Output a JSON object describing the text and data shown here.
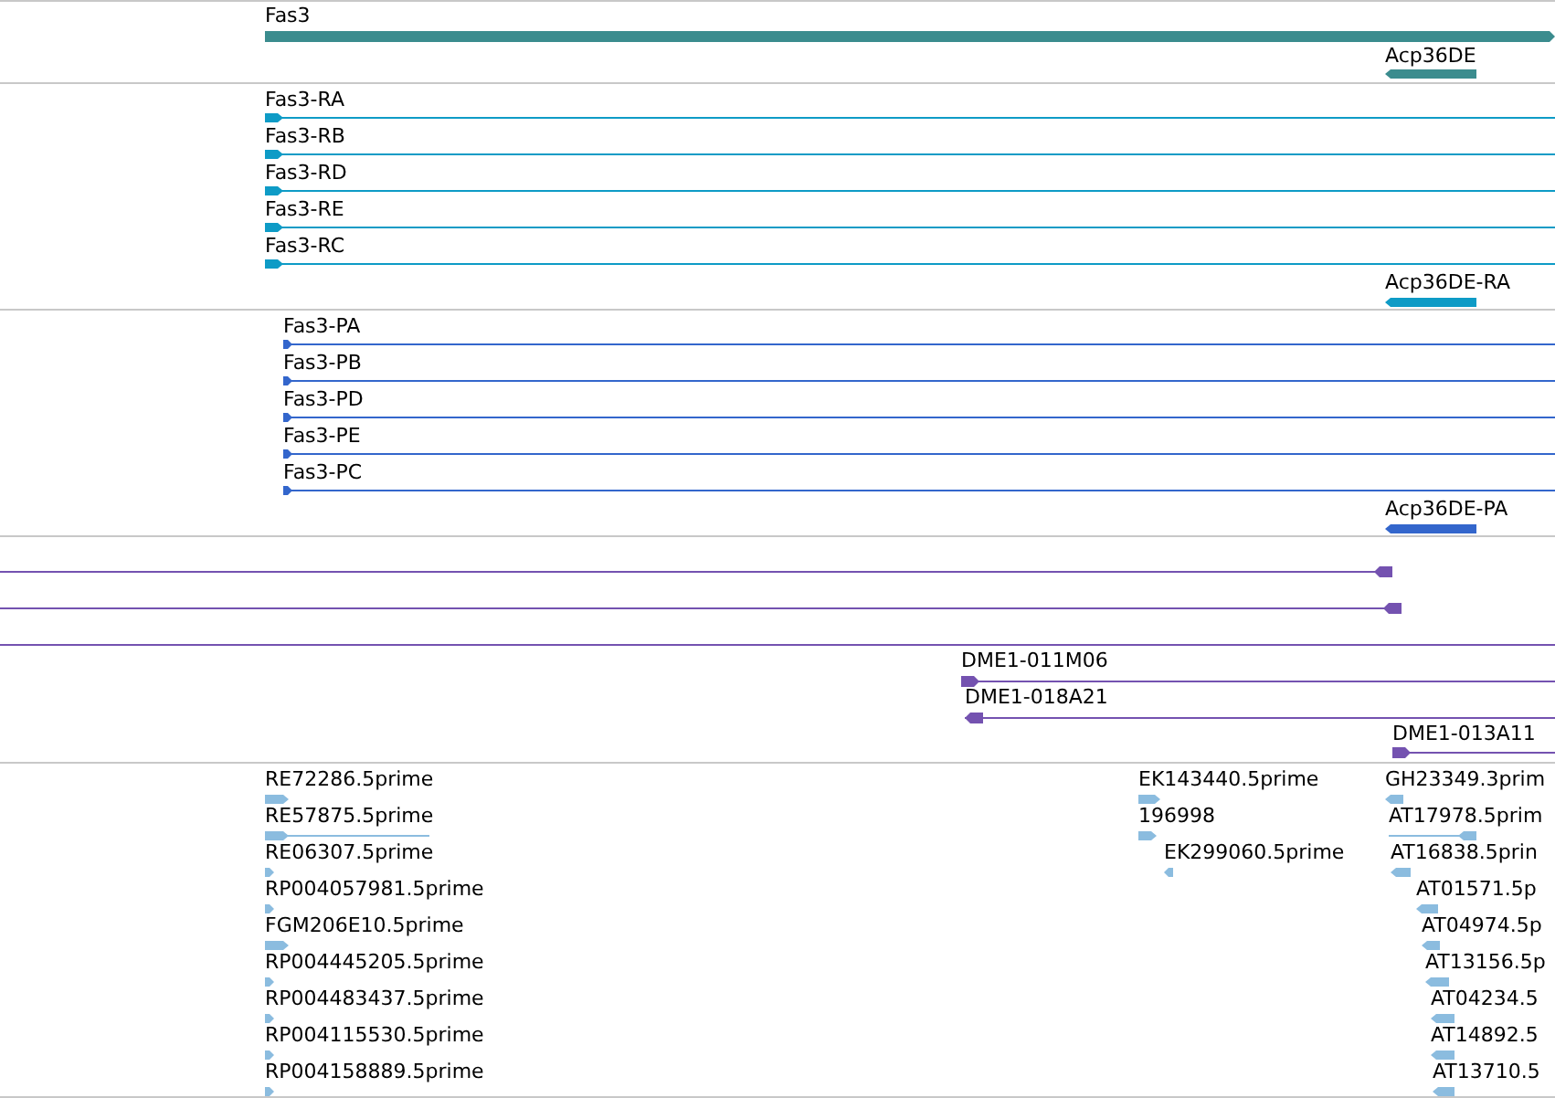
{
  "tracks": [
    {
      "kind": "gene",
      "features": [
        {
          "label": "Fas3",
          "reverse": false
        },
        {
          "label": "Acp36DE",
          "reverse": true
        }
      ]
    },
    {
      "kind": "transcript",
      "features": [
        {
          "label": "Fas3-RA",
          "reverse": false
        },
        {
          "label": "Fas3-RB",
          "reverse": false
        },
        {
          "label": "Fas3-RD",
          "reverse": false
        },
        {
          "label": "Fas3-RE",
          "reverse": false
        },
        {
          "label": "Fas3-RC",
          "reverse": false
        },
        {
          "label": "Acp36DE-RA",
          "reverse": true
        }
      ]
    },
    {
      "kind": "protein",
      "features": [
        {
          "label": "Fas3-PA",
          "reverse": false
        },
        {
          "label": "Fas3-PB",
          "reverse": false
        },
        {
          "label": "Fas3-PD",
          "reverse": false
        },
        {
          "label": "Fas3-PE",
          "reverse": false
        },
        {
          "label": "Fas3-PC",
          "reverse": false
        },
        {
          "label": "Acp36DE-PA",
          "reverse": true
        }
      ]
    },
    {
      "kind": "clone",
      "features": [
        {
          "reverse": true
        },
        {
          "reverse": true
        },
        {
          "label": "DME1-011M06",
          "reverse": false
        },
        {
          "label": "DME1-018A21",
          "reverse": true
        },
        {
          "label": "DME1-013A11",
          "reverse": false
        }
      ]
    },
    {
      "kind": "est",
      "features": [
        {
          "label": "RE72286.5prime",
          "reverse": false
        },
        {
          "label": "RE57875.5prime",
          "reverse": false
        },
        {
          "label": "RE06307.5prime",
          "reverse": false
        },
        {
          "label": "RP004057981.5prime",
          "reverse": false
        },
        {
          "label": "FGM206E10.5prime",
          "reverse": false
        },
        {
          "label": "RP004445205.5prime",
          "reverse": false
        },
        {
          "label": "RP004483437.5prime",
          "reverse": false
        },
        {
          "label": "RP004115530.5prime",
          "reverse": false
        },
        {
          "label": "RP004158889.5prime",
          "reverse": false
        },
        {
          "label": "EK143440.5prime",
          "reverse": false
        },
        {
          "label": "196998",
          "reverse": false
        },
        {
          "label": "EK299060.5prime",
          "reverse": true
        },
        {
          "label": "GH23349.3prim",
          "reverse": true
        },
        {
          "label": "AT17978.5prim",
          "reverse": true
        },
        {
          "label": "AT16838.5prin",
          "reverse": true
        },
        {
          "label": "AT01571.5p",
          "reverse": true
        },
        {
          "label": "AT04974.5p",
          "reverse": true
        },
        {
          "label": "AT13156.5p",
          "reverse": true
        },
        {
          "label": "AT04234.5",
          "reverse": true
        },
        {
          "label": "AT14892.5",
          "reverse": true
        },
        {
          "label": "AT13710.5",
          "reverse": true
        }
      ]
    }
  ]
}
